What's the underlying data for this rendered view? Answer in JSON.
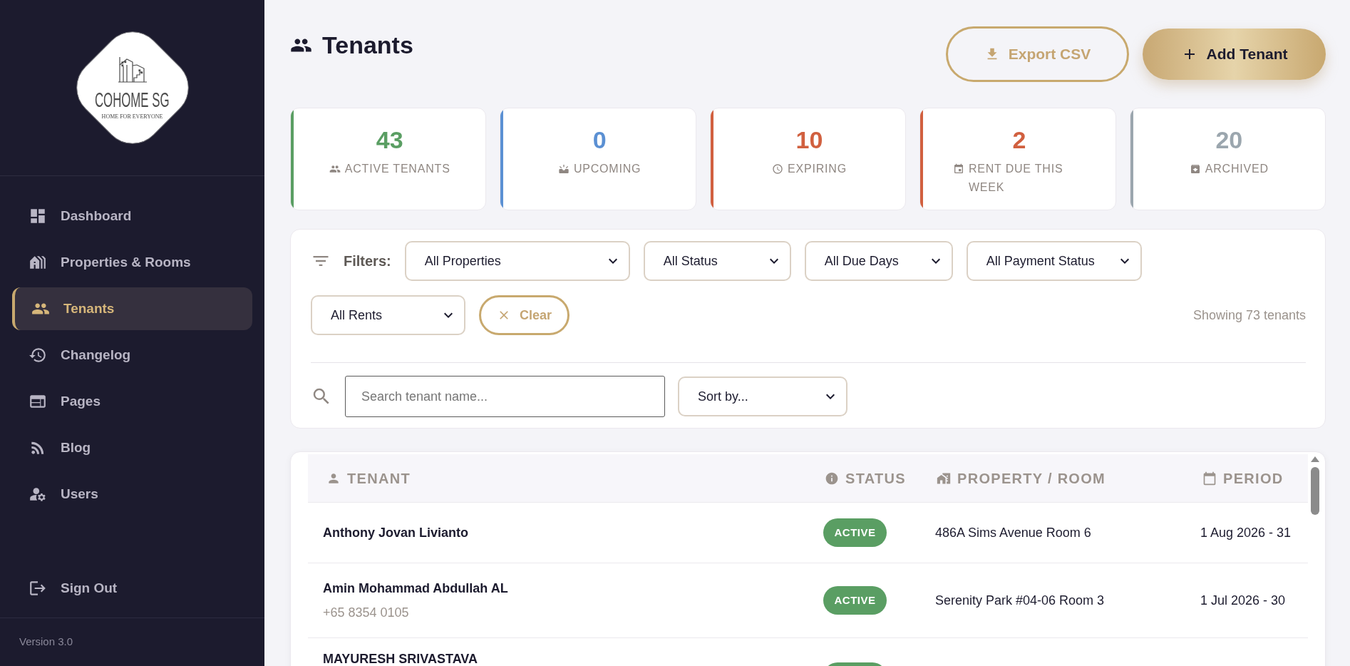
{
  "sidebar": {
    "logo": {
      "brand": "COHOME SG",
      "tagline": "HOME FOR EVERYONE"
    },
    "nav_items": [
      {
        "kind": "dashboard",
        "label": "Dashboard",
        "selected": false
      },
      {
        "kind": "properties",
        "label": "Properties & Rooms",
        "selected": false
      },
      {
        "kind": "tenants",
        "label": "Tenants",
        "selected": true
      },
      {
        "kind": "changelog",
        "label": "Changelog",
        "selected": false
      },
      {
        "kind": "pages",
        "label": "Pages",
        "selected": false
      },
      {
        "kind": "blog",
        "label": "Blog",
        "selected": false
      },
      {
        "kind": "users",
        "label": "Users",
        "selected": false
      }
    ],
    "sign_out": {
      "label": "Sign Out"
    },
    "version": "Version 3.0"
  },
  "header": {
    "title": "Tenants",
    "buttons": [
      {
        "kind": "export",
        "label": "Export CSV"
      },
      {
        "kind": "add",
        "label": "Add Tenant"
      }
    ]
  },
  "stats": [
    {
      "kind": "active",
      "value": "43",
      "label": "ACTIVE TENANTS",
      "color": "#5a9e63"
    },
    {
      "kind": "upcoming",
      "value": "0",
      "label": "UPCOMING",
      "color": "#5b90d3"
    },
    {
      "kind": "expiring",
      "value": "10",
      "label": "EXPIRING",
      "color": "#d1603f"
    },
    {
      "kind": "rent_due",
      "value": "2",
      "label": "RENT DUE THIS WEEK",
      "color": "#d1603f"
    },
    {
      "kind": "archived",
      "value": "20",
      "label": "ARCHIVED",
      "color": "#9ba6ae"
    }
  ],
  "filters": {
    "label": "Filters:",
    "selects": [
      {
        "value": "All Properties"
      },
      {
        "value": "All Status"
      },
      {
        "value": "All Due Days"
      },
      {
        "value": "All Payment Status"
      },
      {
        "value": "All Rents"
      }
    ],
    "clear": "Clear",
    "result_count": "Showing 73 tenants",
    "search": {
      "placeholder": "Search tenant name..."
    },
    "sort": {
      "value": "Sort by..."
    }
  },
  "table": {
    "columns": [
      {
        "kind": "tenant",
        "label": "TENANT"
      },
      {
        "kind": "status",
        "label": "STATUS"
      },
      {
        "kind": "property",
        "label": "PROPERTY / ROOM"
      },
      {
        "kind": "period",
        "label": "PERIOD"
      }
    ],
    "rows": [
      {
        "name": "Anthony Jovan Livianto",
        "status": {
          "label": "ACTIVE",
          "color": "#5a9e63"
        },
        "property": "486A Sims Avenue Room 6",
        "period": "1 Aug 2026 - 31"
      },
      {
        "name": "Amin Mohammad Abdullah AL",
        "phone": "+65 8354 0105",
        "status": {
          "label": "ACTIVE",
          "color": "#5a9e63"
        },
        "property": "Serenity Park #04-06 Room 3",
        "period": "1 Jul 2026 - 30"
      },
      {
        "name": "MAYURESH SRIVASTAVA",
        "status": {
          "color": "#5a9e63"
        }
      }
    ]
  }
}
